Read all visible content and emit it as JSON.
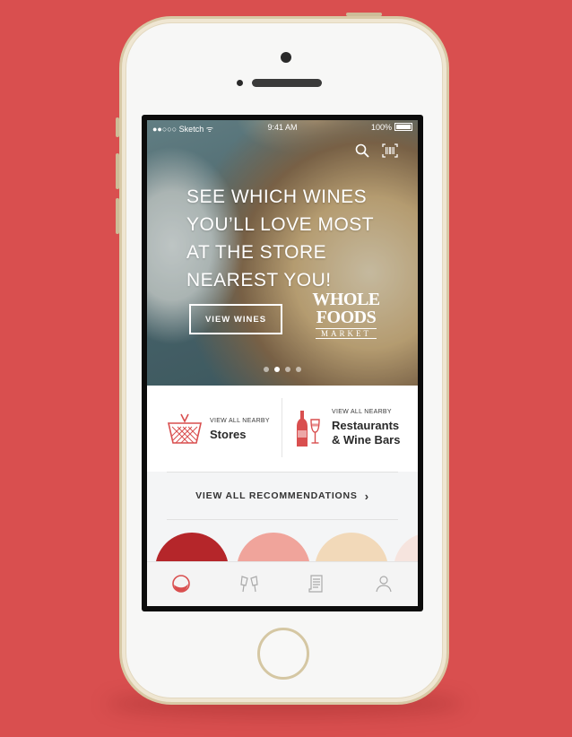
{
  "status_bar": {
    "carrier": "●●○○○ Sketch ᯤ",
    "time": "9:41 AM",
    "battery": "100%"
  },
  "hero": {
    "title": "SEE WHICH WINES\nYOU’LL LOVE MOST\nAT THE STORE\nNEAREST YOU!",
    "cta_label": "VIEW WINES",
    "logo_line1": "WHOLE",
    "logo_line2": "FOODS",
    "logo_line3": "MARKET",
    "carousel_pages": 4,
    "carousel_active": 2
  },
  "nearby": {
    "stores_small": "VIEW ALL NEARBY",
    "stores_big": "Stores",
    "restaurants_small": "VIEW ALL NEARBY",
    "restaurants_big": "Restaurants\n& Wine Bars"
  },
  "recommendations": {
    "label": "VIEW ALL RECOMMENDATIONS",
    "chevron": "›"
  },
  "wine_colors": [
    "#b5262a",
    "#f0a49b",
    "#f2d9b9",
    "#f6e4de"
  ],
  "tabs": [
    "glass-icon",
    "toast-icon",
    "menu-list-icon",
    "profile-icon"
  ],
  "colors": {
    "accent": "#d94f4f",
    "background": "#d94f4f"
  }
}
